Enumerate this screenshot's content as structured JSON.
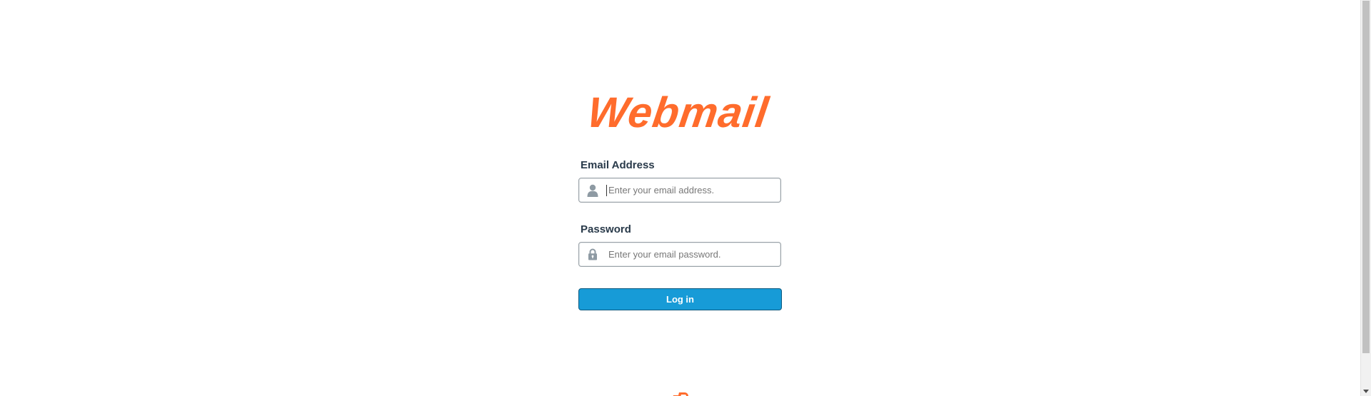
{
  "logo": {
    "text": "Webmail",
    "color": "#ff6c2c"
  },
  "form": {
    "email": {
      "label": "Email Address",
      "placeholder": "Enter your email address.",
      "value": "",
      "icon": "user-icon"
    },
    "password": {
      "label": "Password",
      "placeholder": "Enter your email password.",
      "value": "",
      "icon": "lock-icon"
    },
    "submit_label": "Log in"
  },
  "colors": {
    "accent": "#179bd7",
    "button_border": "#0d5a80",
    "label": "#293a4a",
    "icon": "#8e9aa3",
    "brand": "#ff6c2c"
  },
  "footer": {
    "icon": "cpanel-logo-icon"
  }
}
